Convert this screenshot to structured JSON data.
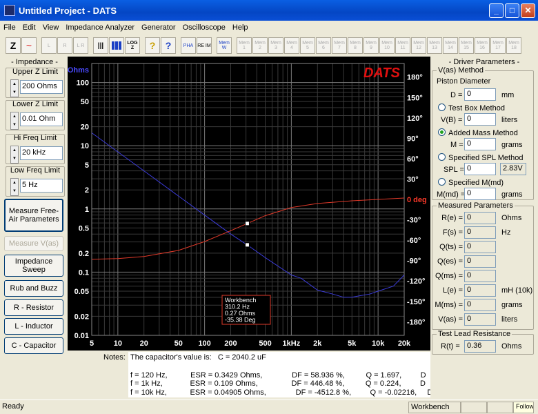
{
  "window": {
    "title": "Untitled Project - DATS"
  },
  "menu": [
    "File",
    "Edit",
    "View",
    "Impedance Analyzer",
    "Generator",
    "Oscilloscope",
    "Help"
  ],
  "toolbar": {
    "tools": [
      "Z",
      "~",
      "L",
      "R",
      "L R",
      "|||",
      "bars",
      "LOG Z",
      "?",
      "?",
      "PHA",
      "RE IM",
      "Mem W"
    ],
    "memories": [
      "Mem 1",
      "Mem 2",
      "Mem 3",
      "Mem 4",
      "Mem 5",
      "Mem 6",
      "Mem 7",
      "Mem 8",
      "Mem 9",
      "Mem 10",
      "Mem 11",
      "Mem 12",
      "Mem 13",
      "Mem 14",
      "Mem 15",
      "Mem 16",
      "Mem 17",
      "Mem 18"
    ]
  },
  "left": {
    "impedance_title": "- Impedance -",
    "upper_z_label": "Upper Z Limit",
    "upper_z": "200 Ohms",
    "lower_z_label": "Lower Z Limit",
    "lower_z": "0.01 Ohm",
    "hi_freq_label": "Hi Freq Limit",
    "hi_freq": "20 kHz",
    "low_freq_label": "Low Freq Limit",
    "low_freq": "5 Hz",
    "measure_free_air": "Measure Free-Air Parameters",
    "measure_vas": "Measure V(as)",
    "impedance_sweep": "Impedance Sweep",
    "rub_buzz": "Rub and Buzz",
    "r_resistor": "R - Resistor",
    "l_inductor": "L - Inductor",
    "c_capacitor": "C - Capacitor"
  },
  "chart_data": {
    "type": "line",
    "title": "DATS",
    "xscale": "log",
    "xlim": [
      5,
      20000
    ],
    "x_ticks": [
      "5",
      "10",
      "20",
      "50",
      "100",
      "200",
      "500",
      "1kHz",
      "2k",
      "5k",
      "10k",
      "20k"
    ],
    "y_left_label": "Ohms",
    "y_left_scale": "log",
    "ylim_left": [
      0.01,
      200
    ],
    "y_left_ticks": [
      "100",
      "50",
      "20",
      "10",
      "5",
      "2",
      "1",
      "0.5",
      "0.2",
      "0.1",
      "0.05",
      "0.02",
      "0.01"
    ],
    "y_right_label": "0 deg",
    "ylim_right": [
      -200,
      200
    ],
    "y_right_ticks": [
      "180°",
      "150°",
      "120°",
      "90°",
      "60°",
      "30°",
      "0 deg",
      "-30°",
      "-60°",
      "-90°",
      "-120°",
      "-150°",
      "-180°"
    ],
    "grid": true,
    "series": [
      {
        "name": "",
        "color": "#3b3bd8",
        "axis": "left",
        "x": [
          5,
          10,
          20,
          50,
          100,
          200,
          310,
          500,
          1000,
          1300,
          2000,
          3000,
          4000,
          5000,
          6000,
          8000,
          10000,
          15000,
          20000
        ],
        "y": [
          16,
          8,
          4,
          1.6,
          0.8,
          0.4,
          0.27,
          0.17,
          0.09,
          0.08,
          0.052,
          0.045,
          0.04,
          0.04,
          0.042,
          0.045,
          0.05,
          0.06,
          0.09
        ]
      },
      {
        "name": "",
        "color": "#e03a2a",
        "axis": "right",
        "x": [
          5,
          10,
          20,
          50,
          100,
          200,
          310,
          500,
          1000,
          2000,
          5000,
          10000,
          20000
        ],
        "y": [
          -88,
          -87,
          -84,
          -75,
          -62,
          -46,
          -35.4,
          -24,
          -12,
          -6,
          -2,
          0,
          2
        ]
      }
    ],
    "marker": {
      "x": 310.2,
      "label_lines": [
        "Workbench",
        "310.2 Hz",
        "0.27 Ohms",
        "-35.38 Deg"
      ]
    }
  },
  "right": {
    "driver_title": "- Driver Parameters -",
    "vas_method": "V(as) Method",
    "piston_diameter": "Piston Diameter",
    "d_label": "D =",
    "d_value": "0",
    "d_unit": "mm",
    "test_box": "Test Box Method",
    "vb_label": "V(B) =",
    "vb_value": "0",
    "vb_unit": "liters",
    "added_mass": "Added Mass Method",
    "m_label": "M =",
    "m_value": "0",
    "m_unit": "grams",
    "spl_method": "Specified SPL Method",
    "spl_label": "SPL =",
    "spl_value": "0",
    "spl_extra": "2.83V",
    "mmd_method": "Specified M(md)",
    "mmd_label": "M(md) =",
    "mmd_value": "0",
    "mmd_unit": "grams",
    "measured_title": "Measured Parameters",
    "params": [
      {
        "label": "R(e) =",
        "value": "0",
        "unit": "Ohms"
      },
      {
        "label": "F(s) =",
        "value": "0",
        "unit": "Hz"
      },
      {
        "label": "Q(ts) =",
        "value": "0",
        "unit": ""
      },
      {
        "label": "Q(es) =",
        "value": "0",
        "unit": ""
      },
      {
        "label": "Q(ms) =",
        "value": "0",
        "unit": ""
      },
      {
        "label": "L(e) =",
        "value": "0",
        "unit": "mH (10k)"
      },
      {
        "label": "M(ms) =",
        "value": "0",
        "unit": "grams"
      },
      {
        "label": "V(as) =",
        "value": "0",
        "unit": "liters"
      }
    ],
    "lead_title": "Test Lead Resistance",
    "rt_label": "R(t) =",
    "rt_value": "0.36",
    "rt_unit": "Ohms"
  },
  "notes": {
    "label": "Notes:",
    "lines": [
      "The capacitor's value is:   C = 2040.2 uF",
      "",
      "f = 120 Hz,           ESR = 0.3429 Ohms,              DF = 58.936 %,          Q = 1.697,         D",
      "f = 1k Hz,             ESR = 0.109 Ohms,                DF = 446.48 %,          Q = 0.224,         D",
      "f = 10k Hz,           ESR = 0.04905 Ohms,              DF = -4512.8 %,         Q = -0.02216,     D"
    ]
  },
  "status": {
    "ready": "Ready",
    "workbench": "Workbench",
    "tooltip": "Follow"
  }
}
